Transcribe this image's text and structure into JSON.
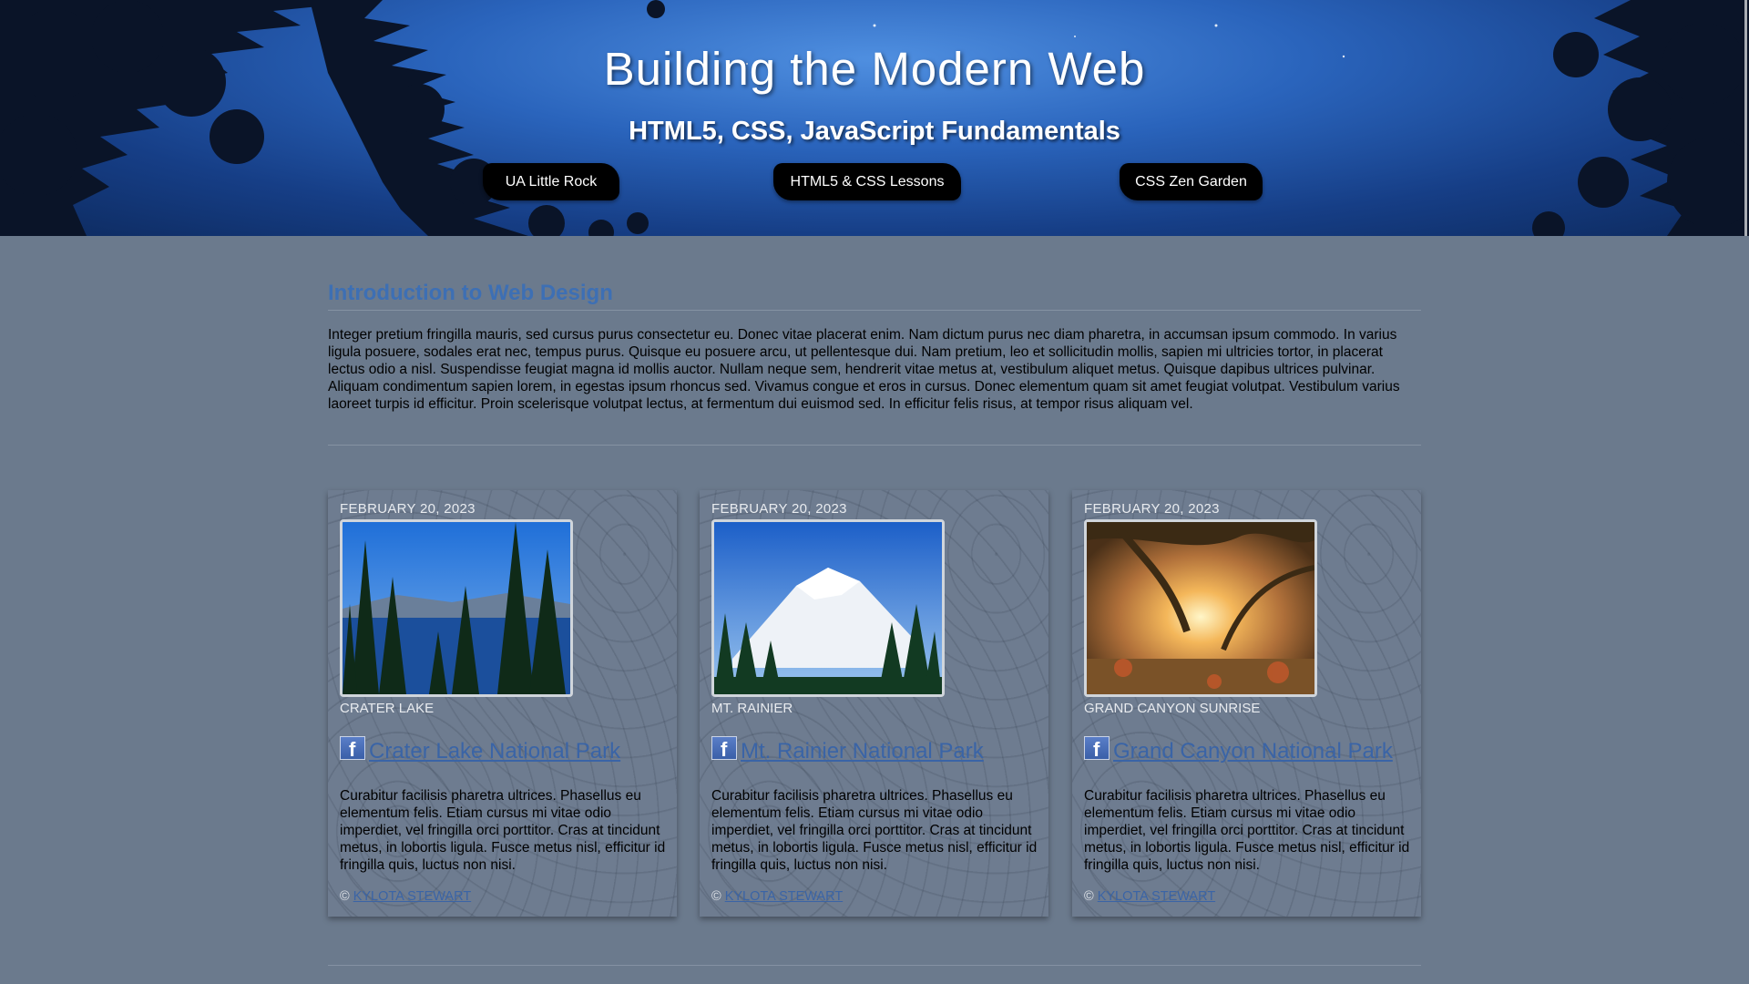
{
  "header": {
    "title": "Building the Modern Web",
    "subtitle": "HTML5, CSS, JavaScript Fundamentals",
    "nav": [
      {
        "label": "UA Little Rock"
      },
      {
        "label": "HTML5 & CSS Lessons"
      },
      {
        "label": "CSS Zen Garden"
      }
    ]
  },
  "intro": {
    "heading": "Introduction to Web Design",
    "text": "Integer pretium fringilla mauris, sed cursus purus consectetur eu. Donec vitae placerat enim. Nam dictum purus nec diam pharetra, in accumsan ipsum commodo. In varius ligula posuere, sodales erat nec, tempus purus. Quisque eu posuere arcu, ut pellentesque dui. Nam pretium, leo et sollicitudin mollis, sapien mi ultricies tortor, in placerat lectus odio a nisl. Suspendisse feugiat magna id mollis auctor. Nullam neque sem, hendrerit vitae metus at, vestibulum aliquet metus. Quisque dapibus ultrices pulvinar. Aliquam condimentum sapien lorem, in egestas ipsum rhoncus sed. Vivamus congue et eros in cursus. Donec elementum quam sit amet feugiat volutpat. Vestibulum varius laoreet turpis id efficitur. Proin scelerisque volutpat lectus, at fermentum dui euismod sed. In efficitur felis risus, at tempor risus aliquam vel."
  },
  "cards": [
    {
      "date": "FEBRUARY 20, 2023",
      "caption": "CRATER LAKE",
      "facebook_icon": "f",
      "link": "Crater Lake National Park",
      "body": "Curabitur facilisis pharetra ultrices. Phasellus eu elementum felis. Etiam cursus mi vitae odio imperdiet, vel fringilla orci porttitor. Cras at tincidunt metus, in lobortis ligula. Fusce metus nisl, efficitur id fringilla quis, luctus non nisi.",
      "copyright": "©",
      "author": "KYLOTA STEWART"
    },
    {
      "date": "FEBRUARY 20, 2023",
      "caption": "MT. RAINIER",
      "facebook_icon": "f",
      "link": "Mt. Rainier National Park",
      "body": "Curabitur facilisis pharetra ultrices. Phasellus eu elementum felis. Etiam cursus mi vitae odio imperdiet, vel fringilla orci porttitor. Cras at tincidunt metus, in lobortis ligula. Fusce metus nisl, efficitur id fringilla quis, luctus non nisi.",
      "copyright": "©",
      "author": "KYLOTA STEWART"
    },
    {
      "date": "FEBRUARY 20, 2023",
      "caption": "GRAND CANYON SUNRISE",
      "facebook_icon": "f",
      "link": "Grand Canyon National Park",
      "body": "Curabitur facilisis pharetra ultrices. Phasellus eu elementum felis. Etiam cursus mi vitae odio imperdiet, vel fringilla orci porttitor. Cras at tincidunt metus, in lobortis ligula. Fusce metus nisl, efficitur id fringilla quis, luctus non nisi.",
      "copyright": "©",
      "author": "KYLOTA STEWART"
    }
  ],
  "colors": {
    "page_background": "#6b7a8d",
    "heading": "#3d6fb4",
    "link": "#3a64a6",
    "nav_button": "#000000"
  }
}
